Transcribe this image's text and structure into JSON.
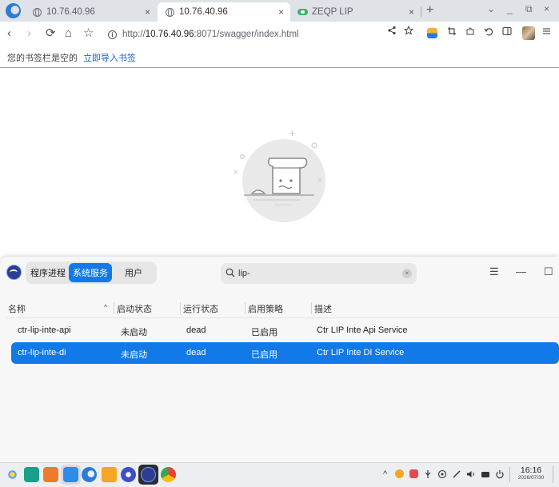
{
  "browser": {
    "tabs": [
      {
        "title": "10.76.40.96",
        "active": false
      },
      {
        "title": "10.76.40.96",
        "active": true
      },
      {
        "title": "ZEQP LIP",
        "active": false
      }
    ],
    "tab_close": "×",
    "new_tab": "+",
    "window_controls": {
      "menu": "⌄",
      "minimize": "_",
      "maximize": "⧉",
      "close": "×"
    },
    "nav": {
      "back": "‹",
      "forward": "›",
      "reload": "⟳",
      "home": "⌂",
      "star": "☆"
    },
    "url": {
      "protocol": "http://",
      "host": "10.76.40.96",
      "path": ":8071/swagger/index.html"
    },
    "bookmarks_bar": {
      "empty_text": "您的书签栏是空的",
      "import_link": "立即导入书签"
    }
  },
  "icons": {
    "browser_logo": "browser-logo-icon",
    "info": "info-icon",
    "share": "share-icon",
    "bookmark_star": "star-icon",
    "empty_state": "empty-document-illustration",
    "search": "search-icon",
    "clear": "clear-icon"
  },
  "monitor": {
    "tabs": [
      {
        "label": "程序进程",
        "active": false
      },
      {
        "label": "系统服务",
        "active": true
      },
      {
        "label": "用户",
        "active": false
      }
    ],
    "search": {
      "value": "lip-",
      "clear": "×"
    },
    "window_controls": {
      "menu": "☰",
      "minimize": "—",
      "maximize": "☐"
    },
    "columns": [
      "名称",
      "启动状态",
      "运行状态",
      "启用策略",
      "描述"
    ],
    "sort_indicator": "^",
    "rows": [
      {
        "name": "ctr-lip-inte-api",
        "start": "未启动",
        "run": "dead",
        "policy": "已启用",
        "desc": "Ctr LIP Inte Api Service",
        "selected": false
      },
      {
        "name": "ctr-lip-inte-di",
        "start": "未启动",
        "run": "dead",
        "policy": "已启用",
        "desc": "Ctr LIP Inte DI Service",
        "selected": true
      }
    ]
  },
  "taskbar": {
    "tray_arrow": "^",
    "time": "16:16",
    "date": "2026/07/30"
  },
  "colors": {
    "accent": "#1279e9",
    "tabstrip": "#dfe3e8",
    "link": "#1a5fd4"
  }
}
